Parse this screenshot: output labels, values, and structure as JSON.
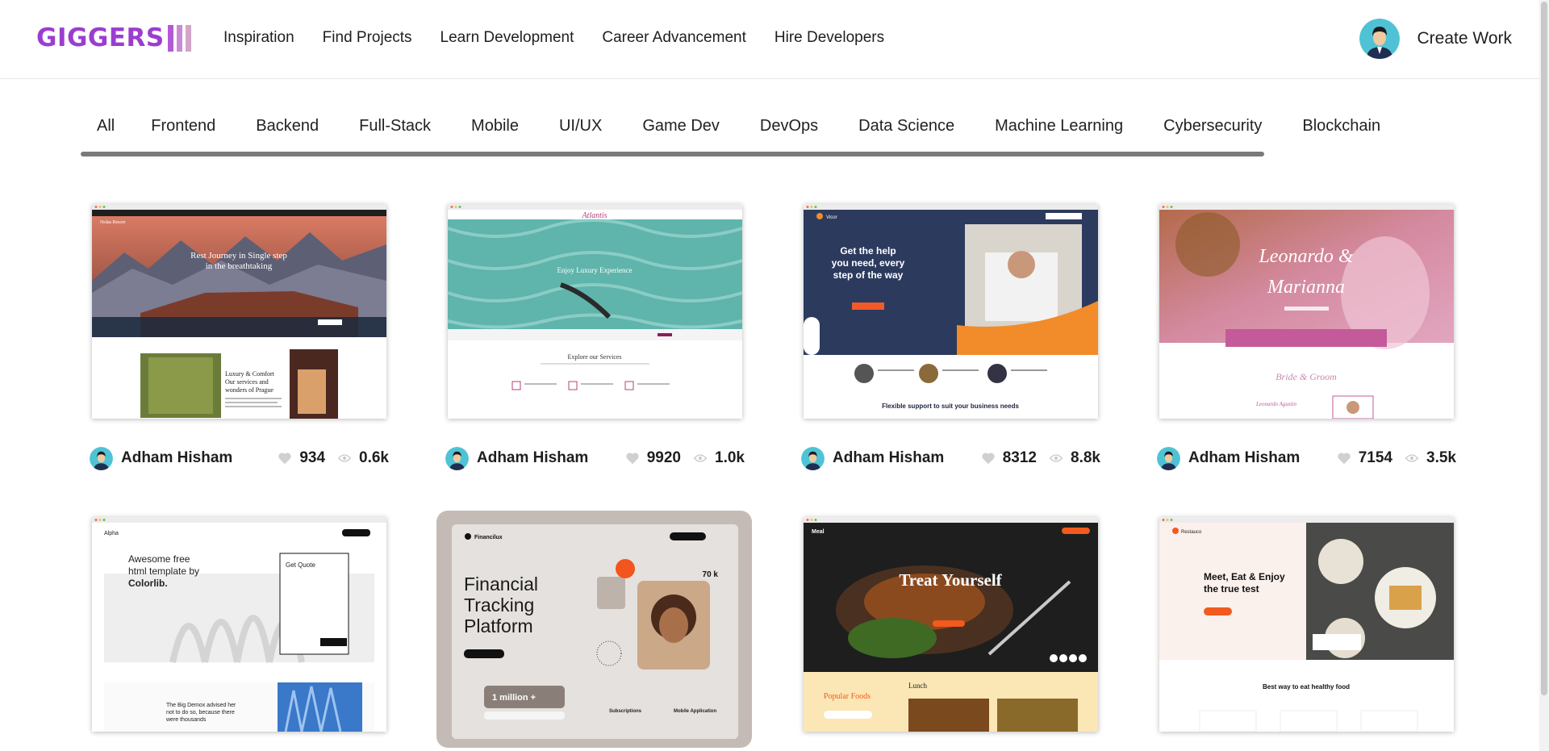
{
  "brand": {
    "logo_text": "GIGGERS",
    "colors": {
      "primary": "#9b3dd0",
      "bar1": "#b25ad6",
      "bar2": "#c98ad8",
      "bar3": "#d4a5c8"
    }
  },
  "nav": {
    "items": [
      {
        "label": "Inspiration"
      },
      {
        "label": "Find Projects"
      },
      {
        "label": "Learn Development"
      },
      {
        "label": "Career Advancement"
      },
      {
        "label": "Hire Developers"
      }
    ]
  },
  "user": {
    "create_label": "Create Work",
    "avatar_icon": "user-avatar"
  },
  "tabs": [
    {
      "label": "All",
      "active": true
    },
    {
      "label": "Frontend"
    },
    {
      "label": "Backend"
    },
    {
      "label": "Full-Stack"
    },
    {
      "label": "Mobile"
    },
    {
      "label": "UI/UX"
    },
    {
      "label": "Game Dev"
    },
    {
      "label": "DevOps"
    },
    {
      "label": "Data Science"
    },
    {
      "label": "Machine Learning"
    },
    {
      "label": "Cybersecurity"
    },
    {
      "label": "Blockchain"
    }
  ],
  "cards": [
    {
      "author": "Adham Hisham",
      "likes": "934",
      "views": "0.6k",
      "preview": {
        "brand": "Nolas Resort",
        "hero_line1": "Rest Journey in Single step",
        "hero_line2": "in the breathtaking",
        "section_title_1": "Luxury & Comfort",
        "section_title_2": "Our services and",
        "section_title_3": "wonders of Prague"
      }
    },
    {
      "author": "Adham Hisham",
      "likes": "9920",
      "views": "1.0k",
      "preview": {
        "brand": "Atlantis",
        "hero": "Enjoy Luxury Experience",
        "section_title": "Explore our Services"
      }
    },
    {
      "author": "Adham Hisham",
      "likes": "8312",
      "views": "8.8k",
      "preview": {
        "brand": "Vicor",
        "hero_line1": "Get the help",
        "hero_line2": "you need, every",
        "hero_line3": "step of the way",
        "footer": "Flexible support to suit your business needs"
      }
    },
    {
      "author": "Adham Hisham",
      "likes": "7154",
      "views": "3.5k",
      "preview": {
        "name1": "Leonardo &",
        "name2": "Marianna",
        "subtitle": "Bride & Groom",
        "signature": "Leonardo Agustin"
      }
    },
    {
      "preview": {
        "brand": "Alpha",
        "quote_1": "Awesome free",
        "quote_2": "html template by",
        "quote_3": "Colorlib.",
        "cta_title": "Get Quote",
        "mission_1": "The Big Demox advised her",
        "mission_2": "not to do so, because there",
        "mission_3": "were thousands"
      }
    },
    {
      "preview": {
        "brand": "Financilux",
        "title_1": "Financial",
        "title_2": "Tracking",
        "title_3": "Platform",
        "stat": "70 k",
        "badge": "1 million +",
        "feature_1": "Subscriptions",
        "feature_2": "Mobile Application"
      }
    },
    {
      "preview": {
        "brand": "Meal",
        "hero": "Treat Yourself",
        "section_1": "Popular Foods",
        "section_2": "Lunch"
      }
    },
    {
      "preview": {
        "brand": "Restauco",
        "hero_1": "Meet, Eat & Enjoy",
        "hero_2": "the true test",
        "section": "Best way to eat healthy food"
      }
    }
  ]
}
